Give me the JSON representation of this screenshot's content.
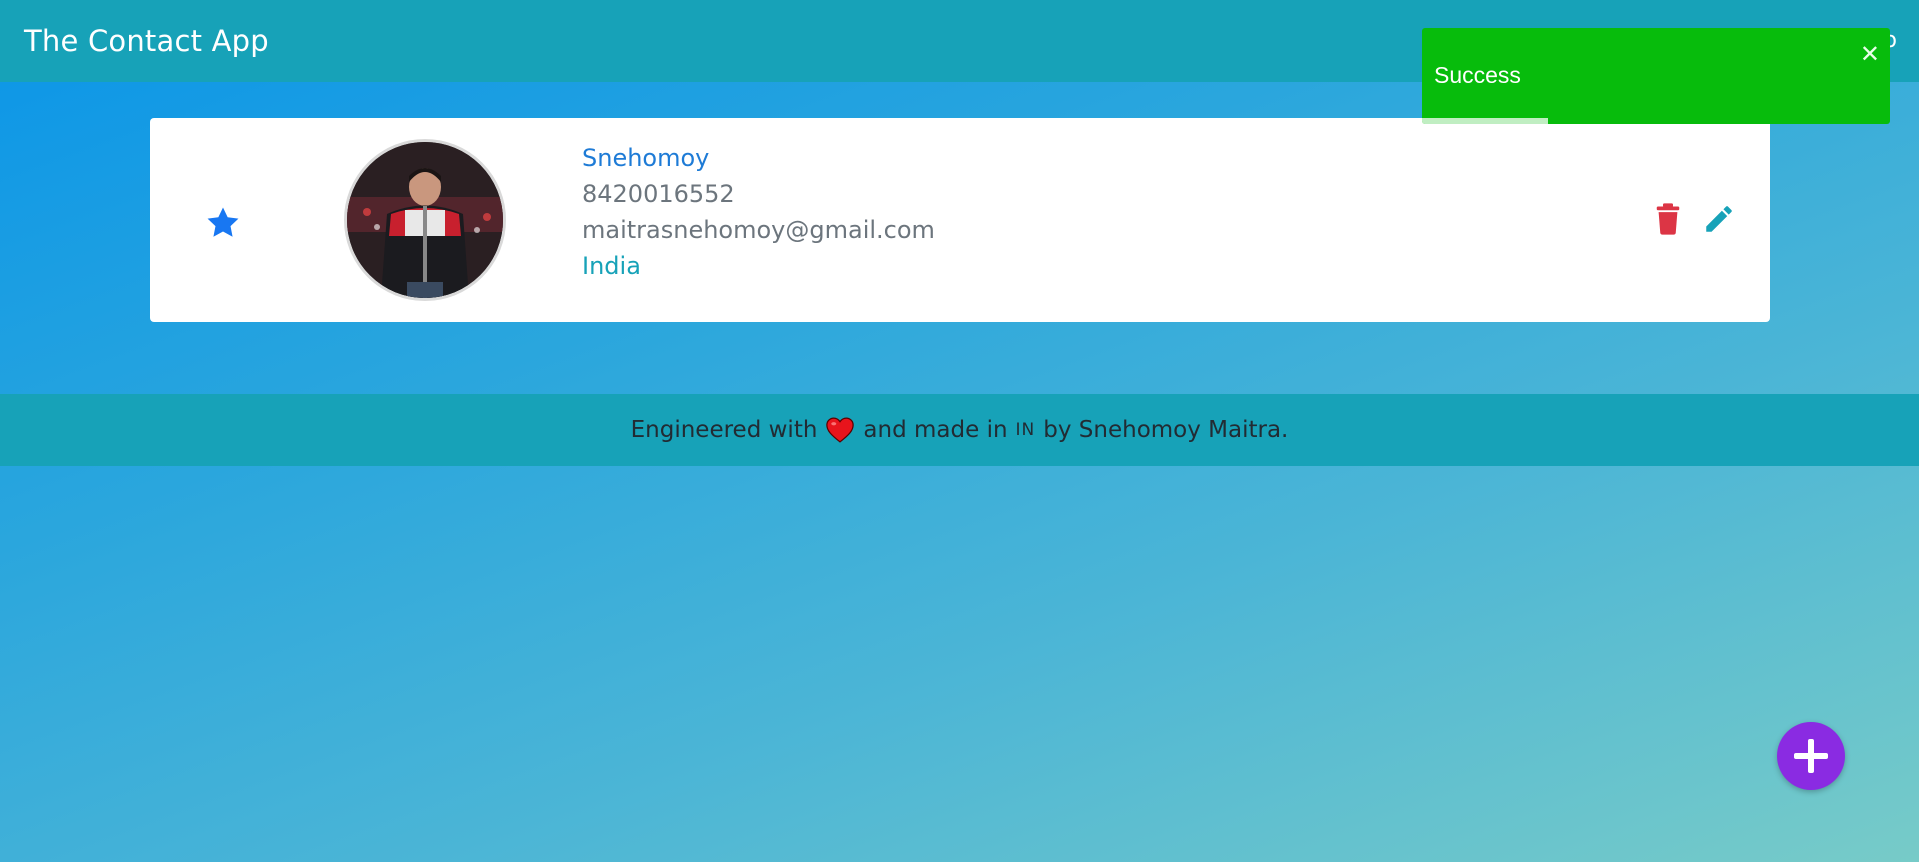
{
  "navbar": {
    "brand": "The Contact App",
    "right_glyph": "o"
  },
  "contact": {
    "name": "Snehomoy",
    "phone": "8420016552",
    "email": "maitrasnehomoy@gmail.com",
    "country": "India",
    "is_favorite": true,
    "favorite_icon": "star-icon",
    "delete_icon": "trash-icon",
    "edit_icon": "pencil-icon"
  },
  "footer": {
    "prefix": "Engineered with",
    "heart_icon": "heart-icon",
    "middle": "and made in",
    "flag_text": "IN",
    "suffix": "by Snehomoy Maitra."
  },
  "toast": {
    "message": "Success",
    "close_label": "✕",
    "progress": 0.27
  },
  "fab": {
    "icon": "plus-icon"
  },
  "colors": {
    "navbar": "#17a2b8",
    "favorite": "#1877f2",
    "delete": "#dc3545",
    "edit": "#17a2b8",
    "toast": "#07bc0c",
    "fab": "#8a2be2"
  }
}
